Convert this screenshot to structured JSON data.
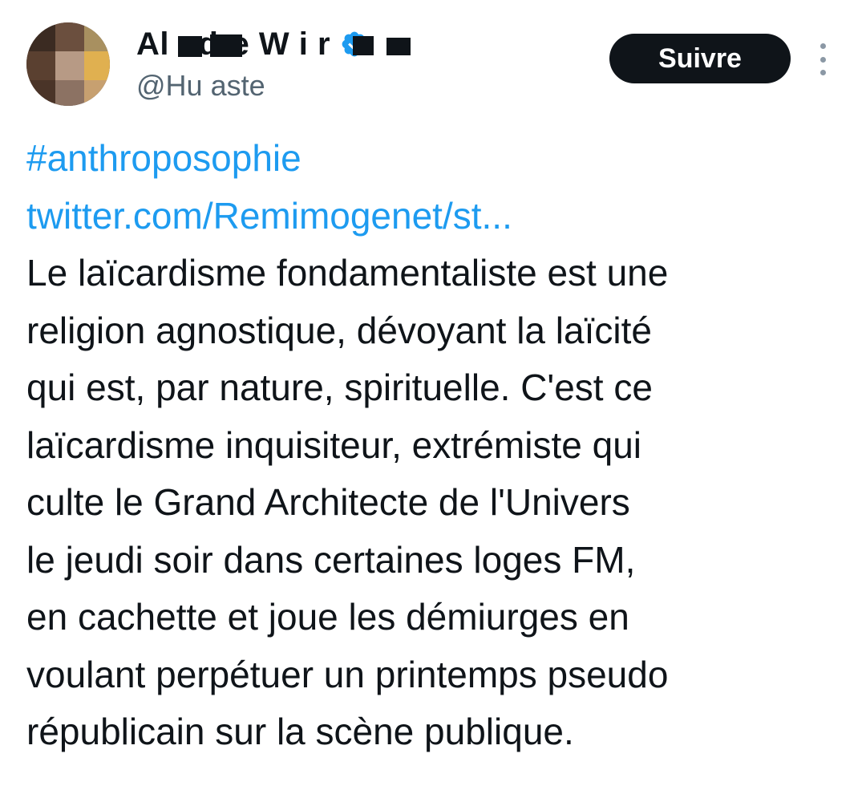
{
  "tweet": {
    "author": {
      "display_name_visible": "Al  ndre W  i r",
      "handle_visible": "@Hu  aste",
      "verified_icon": "verified-badge-icon",
      "avatar": "profile-avatar-pixelated"
    },
    "follow_button_label": "Suivre",
    "more_icon": "more-vertical-icon",
    "hashtag": "#anthroposophie",
    "link_text": "twitter.com/Remimogenet/st...",
    "body_lines": [
      "Le laïcardisme fondamentaliste est une",
      "religion agnostique, dévoyant la laïcité",
      "qui est, par nature, spirituelle. C'est ce",
      "laïcardisme inquisiteur, extrémiste qui",
      "culte le Grand Architecte de l'Univers",
      "le jeudi soir dans certaines loges FM,",
      "en cachette et joue les démiurges en",
      "voulant perpétuer un printemps pseudo",
      "républicain sur la scène publique."
    ]
  },
  "colors": {
    "link": "#1d9bf0",
    "text": "#0f1419",
    "secondary_text": "#536471",
    "follow_button_bg": "#0f1419",
    "follow_button_text": "#ffffff",
    "verified_badge": "#1d9bf0"
  }
}
